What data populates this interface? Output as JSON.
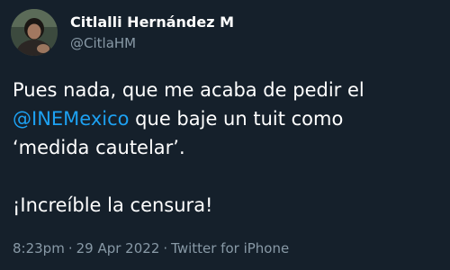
{
  "author": {
    "display_name": "Citlalli Hernández M",
    "handle": "@CitlaHM",
    "avatar_icon": "user-avatar"
  },
  "tweet": {
    "line1": "Pues nada, que me acaba de pedir el",
    "mention": "@INEMexico",
    "line2_rest": " que baje un tuit como",
    "line3": "‘medida cautelar’.",
    "line4": "¡Increíble la censura!"
  },
  "meta": {
    "time": "8:23pm",
    "separator": "·",
    "date": "29 Apr 2022",
    "source": "Twitter for iPhone"
  },
  "colors": {
    "background": "#15202b",
    "text": "#ffffff",
    "secondary": "#8899a6",
    "link": "#1da1f2"
  }
}
